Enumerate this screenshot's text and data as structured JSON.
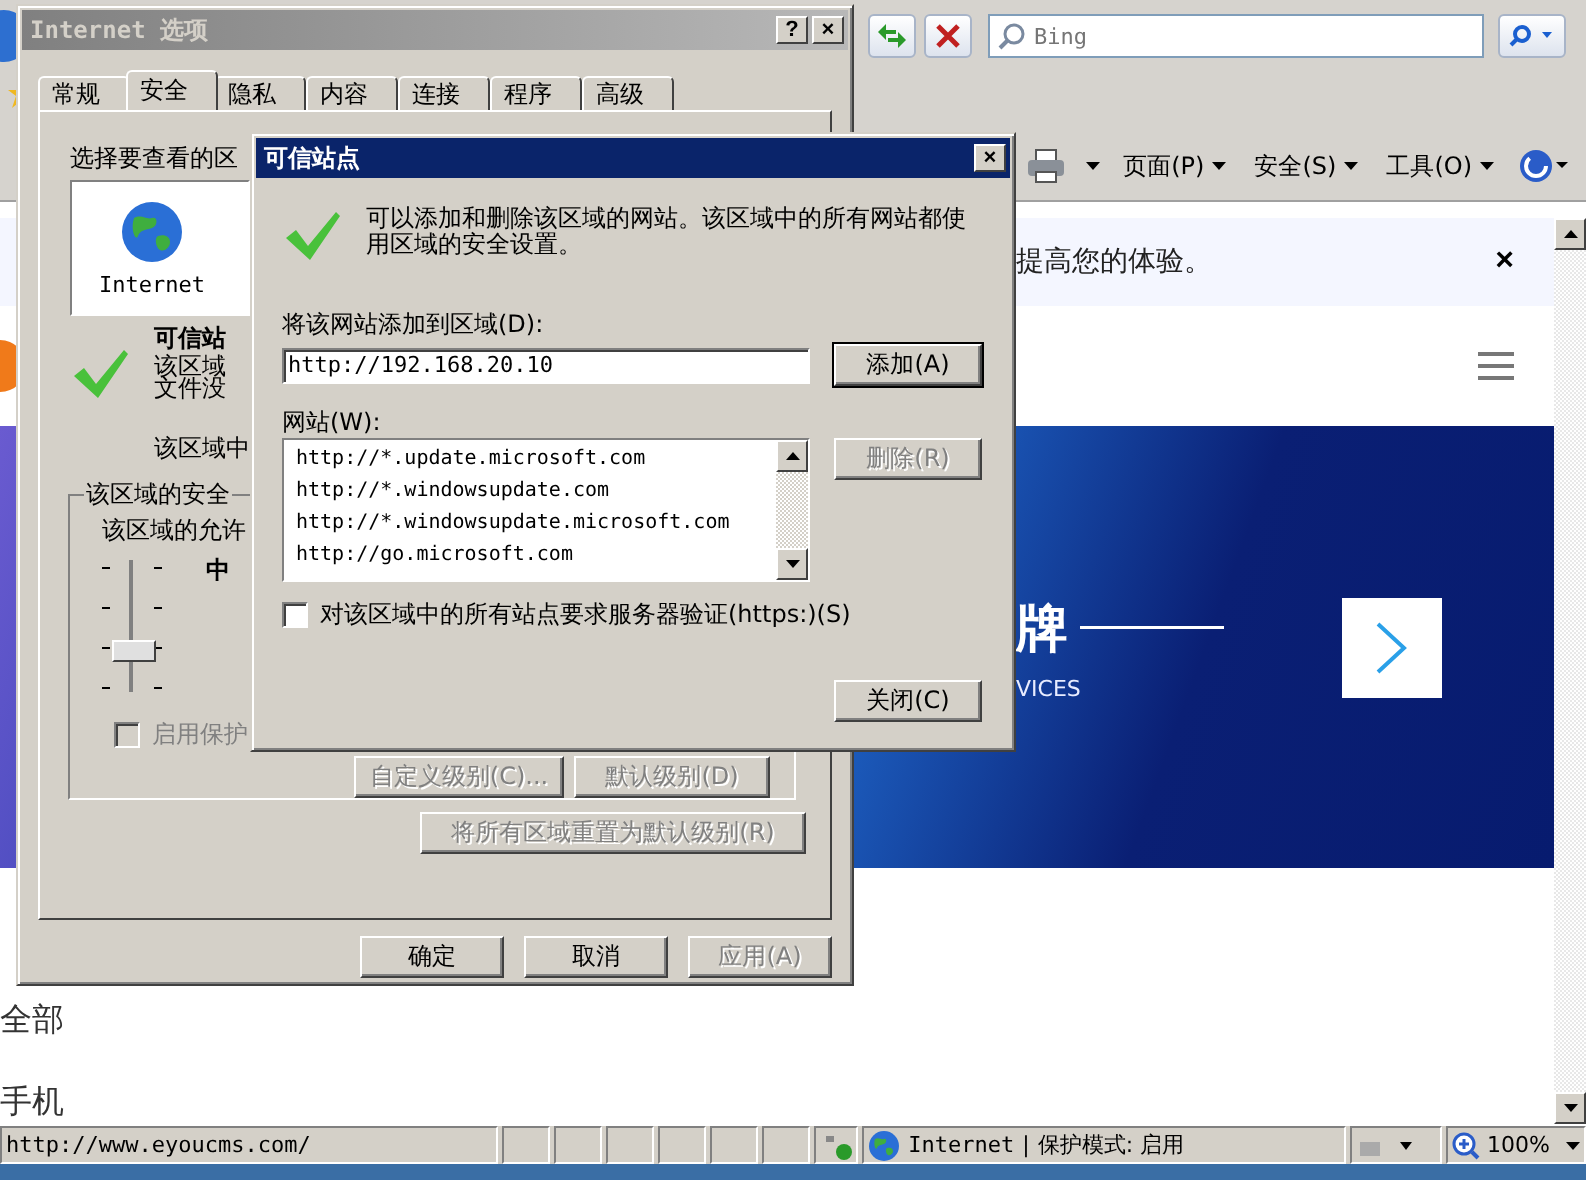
{
  "browser": {
    "search_placeholder": "Bing",
    "command_menus": [
      "页面(P)",
      "安全(S)",
      "工具(O)"
    ],
    "notification": "提高您的体验。",
    "notification_close": "×",
    "banner_title": "牌",
    "banner_subtitle": "VICES",
    "page_texts": [
      "全部",
      "手机"
    ],
    "status": {
      "url": "http://www.eyoucms.com/",
      "zone": "Internet",
      "separator": "|",
      "protected_mode": "保护模式: 启用",
      "zoom": "100%"
    }
  },
  "internet_options": {
    "title": "Internet 选项",
    "help": "?",
    "close": "×",
    "tabs": [
      {
        "label": "常规",
        "selected": false
      },
      {
        "label": "安全",
        "selected": true
      },
      {
        "label": "隐私",
        "selected": false
      },
      {
        "label": "内容",
        "selected": false
      },
      {
        "label": "连接",
        "selected": false
      },
      {
        "label": "程序",
        "selected": false
      },
      {
        "label": "高级",
        "selected": false
      }
    ],
    "zone_prompt": "选择要查看的区",
    "zones": [
      {
        "label": "Internet",
        "selected": false
      }
    ],
    "zone_name": "可信站",
    "zone_description": [
      "该区域",
      "文件没"
    ],
    "zone_sites_note": "该区域中",
    "security_group": "该区域的安全",
    "allowed_label": "该区域的允许",
    "slider": {
      "level": 0.33
    },
    "level_name": "中",
    "protected_mode": {
      "label": "启用保护",
      "checked": false,
      "disabled": true
    },
    "level_buttons": [
      {
        "label": "自定义级别(C)...",
        "disabled": true
      },
      {
        "label": "默认级别(D)",
        "disabled": true
      }
    ],
    "reset_button": {
      "label": "将所有区域重置为默认级别(R)",
      "disabled": true
    },
    "buttons": [
      {
        "label": "确定",
        "disabled": false
      },
      {
        "label": "取消",
        "disabled": false
      },
      {
        "label": "应用(A)",
        "disabled": true
      }
    ]
  },
  "trusted_sites": {
    "title": "可信站点",
    "close": "×",
    "description": "可以添加和删除该区域的网站。该区域中的所有网站都使用区域的安全设置。",
    "add_label": "将该网站添加到区域(D):",
    "add_value": "http://192.168.20.10",
    "add_button": {
      "label": "添加(A)",
      "disabled": false
    },
    "sites_label": "网站(W):",
    "sites": [
      {
        "label": "http://*.update.microsoft.com",
        "selected": false
      },
      {
        "label": "http://*.windowsupdate.com",
        "selected": false
      },
      {
        "label": "http://*.windowsupdate.microsoft.com",
        "selected": false
      },
      {
        "label": "http://go.microsoft.com",
        "selected": false
      }
    ],
    "remove_button": {
      "label": "删除(R)",
      "disabled": true
    },
    "https_required": {
      "label": "对该区域中的所有站点要求服务器验证(https:)(S)",
      "checked": false
    },
    "close_button": {
      "label": "关闭(C)",
      "disabled": false
    }
  }
}
